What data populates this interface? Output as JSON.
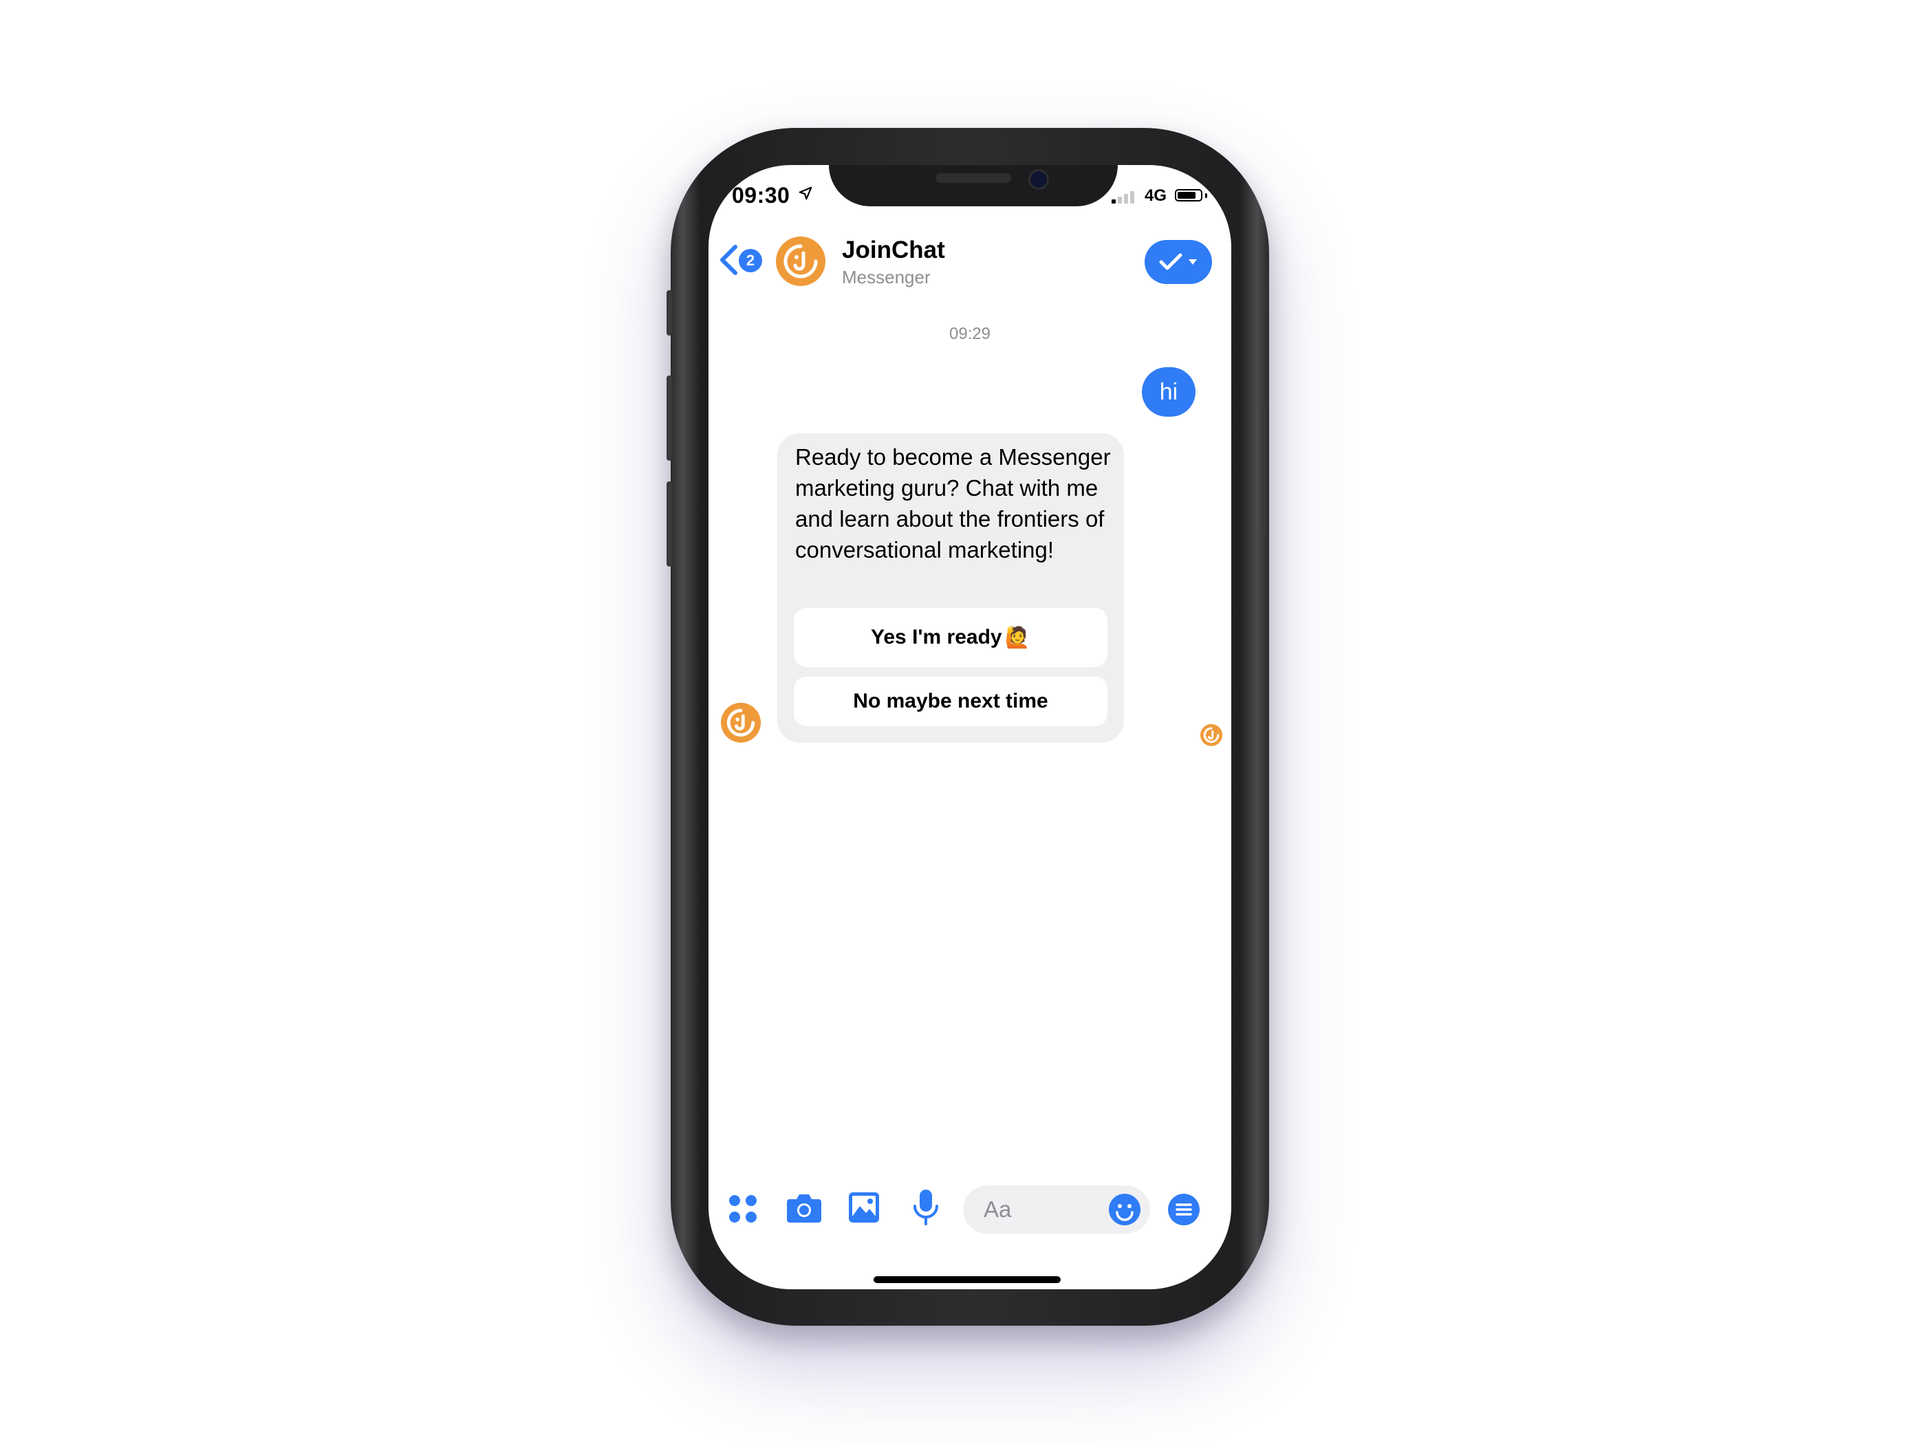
{
  "status_bar": {
    "time": "09:30",
    "network": "4G"
  },
  "header": {
    "back_badge": "2",
    "title": "JoinChat",
    "subtitle": "Messenger"
  },
  "conversation": {
    "timestamp": "09:29",
    "outgoing_message": "hi",
    "bot_message": {
      "text": "Ready to become a Messenger marketing guru? Chat with me and learn about the frontiers of conversational marketing!",
      "quick_replies": [
        "Yes I'm ready",
        "No maybe next time"
      ],
      "quick_reply_emoji": "🙋"
    }
  },
  "composer": {
    "placeholder": "Aa"
  },
  "icons": [
    "location-arrow-icon",
    "signal-icon",
    "battery-icon",
    "back-chevron-icon",
    "checkmark-icon",
    "caret-down-icon",
    "apps-grid-icon",
    "camera-icon",
    "gallery-icon",
    "microphone-icon",
    "emoji-icon",
    "menu-icon"
  ],
  "colors": {
    "accent": "#2f7cf6",
    "brand": "#ef9a39",
    "bubble_gray": "#efefef"
  }
}
